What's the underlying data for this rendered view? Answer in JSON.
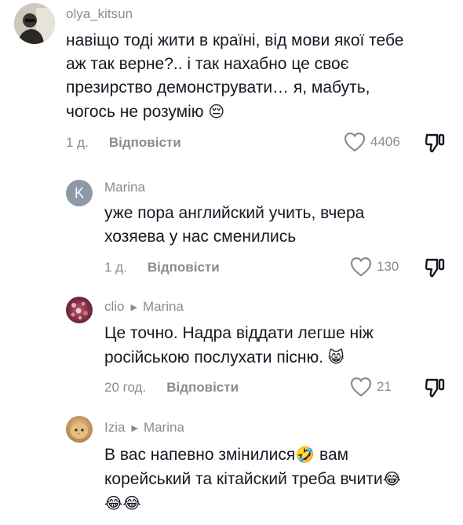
{
  "comments": [
    {
      "username": "olya_kitsun",
      "text_lines": [
        "навіщо тоді жити в країні, від мови якої тебе",
        "аж так верне?.. і так нахабно це своє",
        "презирство демонструвати… я, мабуть,",
        "чогось не розумію"
      ],
      "emoji": "😔",
      "time": "1 д.",
      "reply_label": "Відповісти",
      "likes": "4406"
    },
    {
      "username": "Marina",
      "avatar_letter": "K",
      "text_lines": [
        "уже пора английский учить, вчера",
        "хозяева у нас сменились"
      ],
      "time": "1 д.",
      "reply_label": "Відповісти",
      "likes": "130"
    },
    {
      "username": "clio",
      "reply_to": "Marina",
      "text_lines": [
        "Це точно. Надра віддати легше ніж",
        "російською послухати пісню."
      ],
      "emoji": "😸",
      "time": "20 год.",
      "reply_label": "Відповісти",
      "likes": "21"
    },
    {
      "username": "Izia",
      "reply_to": "Marina",
      "text_lines": [
        "В вас напевно змінилися",
        "корейський та кітайский треба вчити",
        ""
      ],
      "emoji_line1": "🤣",
      "line1_tail": " вам",
      "emoji_line2": "😂",
      "line3_emojis": "😂😂"
    }
  ],
  "colors": {
    "text": "#161823",
    "muted": "#8a8b91",
    "avatar_k": "#8d9aa6"
  }
}
